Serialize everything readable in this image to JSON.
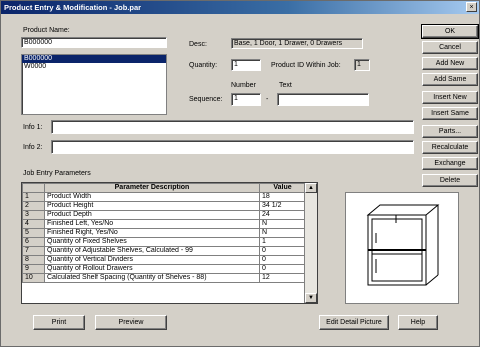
{
  "window": {
    "title": "Product Entry & Modification - Job.par",
    "close": "×"
  },
  "product": {
    "name_label": "Product Name:",
    "name_value": "B000000",
    "list": [
      "B000000",
      "W0000"
    ],
    "selected_index": 0
  },
  "desc": {
    "label": "Desc:",
    "value": "Base, 1 Door, 1 Drawer, 0 Drawers"
  },
  "quantity": {
    "label": "Quantity:",
    "value": "1"
  },
  "product_id": {
    "label": "Product ID Within Job:",
    "value": "1"
  },
  "sequence": {
    "label": "Sequence:",
    "number_label": "Number",
    "text_label": "Text",
    "number_value": "1",
    "text_value": ""
  },
  "info1": {
    "label": "Info 1:",
    "value": ""
  },
  "info2": {
    "label": "Info 2:",
    "value": ""
  },
  "params": {
    "title": "Job Entry Parameters",
    "col_desc": "Parameter Description",
    "col_value": "Value",
    "rows": [
      {
        "n": "1",
        "desc": "Product Width",
        "value": "18"
      },
      {
        "n": "2",
        "desc": "Product Height",
        "value": "34 1/2"
      },
      {
        "n": "3",
        "desc": "Product Depth",
        "value": "24"
      },
      {
        "n": "4",
        "desc": "Finished Left, Yes/No",
        "value": "N"
      },
      {
        "n": "5",
        "desc": "Finished Right, Yes/No",
        "value": "N"
      },
      {
        "n": "6",
        "desc": "Quantity of Fixed Shelves",
        "value": "1"
      },
      {
        "n": "7",
        "desc": "Quantity of Adjustable Shelves, Calculated - 99",
        "value": "0"
      },
      {
        "n": "8",
        "desc": "Quantity of Vertical Dividers",
        "value": "0"
      },
      {
        "n": "9",
        "desc": "Quantity of Rollout Drawers",
        "value": "0"
      },
      {
        "n": "10",
        "desc": "Calculated Shelf Spacing (Quantity of Shelves - 88)",
        "value": "12"
      }
    ]
  },
  "side_buttons": [
    "OK",
    "Cancel",
    "Add New",
    "Add Same",
    "Insert New",
    "Insert Same",
    "Parts...",
    "Recalculate",
    "Exchange",
    "Delete"
  ],
  "bottom": {
    "print": "Print",
    "preview": "Preview",
    "edit_detail": "Edit Detail Picture",
    "help": "Help"
  },
  "icons": {
    "scroll_up": "▲",
    "scroll_down": "▼"
  }
}
